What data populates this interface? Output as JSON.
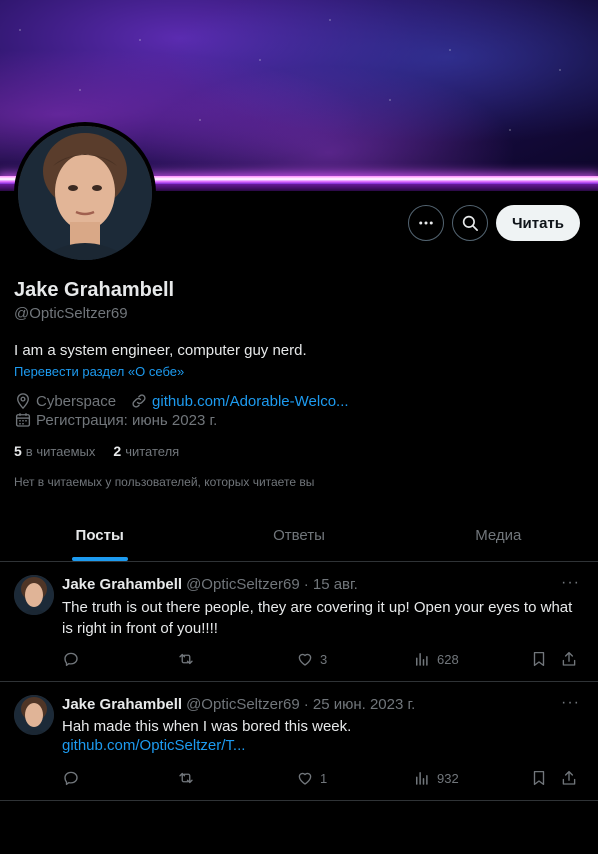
{
  "profile": {
    "name": "Jake Grahambell",
    "handle": "@OpticSeltzer69",
    "bio": "I am a system engineer, computer guy nerd.",
    "translate_bio": "Перевести раздел «О себе»",
    "location": "Cyberspace",
    "website": "github.com/Adorable-Welco...",
    "joined": "Регистрация: июнь 2023 г.",
    "following_count": "5",
    "following_label": "в читаемых",
    "followers_count": "2",
    "followers_label": "читателя",
    "mutual_note": "Нет в читаемых у пользователей, которых читаете вы"
  },
  "actions": {
    "follow_label": "Читать",
    "more_icon": "more-icon",
    "search_icon": "search-icon"
  },
  "tabs": [
    {
      "label": "Посты",
      "active": true
    },
    {
      "label": "Ответы",
      "active": false
    },
    {
      "label": "Медиа",
      "active": false
    }
  ],
  "tweets": [
    {
      "name": "Jake Grahambell",
      "handle": "@OpticSeltzer69",
      "date": "· 15 авг.",
      "text": "The truth is out there people, they are covering it up! Open your eyes to what is right in front of you!!!!",
      "link": "",
      "likes": "3",
      "views": "628"
    },
    {
      "name": "Jake Grahambell",
      "handle": "@OpticSeltzer69",
      "date": "· 25 июн. 2023 г.",
      "text": "Hah made this when I was bored this week.",
      "link": "github.com/OpticSeltzer/T...",
      "likes": "1",
      "views": "932"
    }
  ],
  "colors": {
    "accent": "#1d9bf0",
    "muted": "#71767b",
    "text": "#e7e9ea",
    "border": "#2f3336"
  }
}
